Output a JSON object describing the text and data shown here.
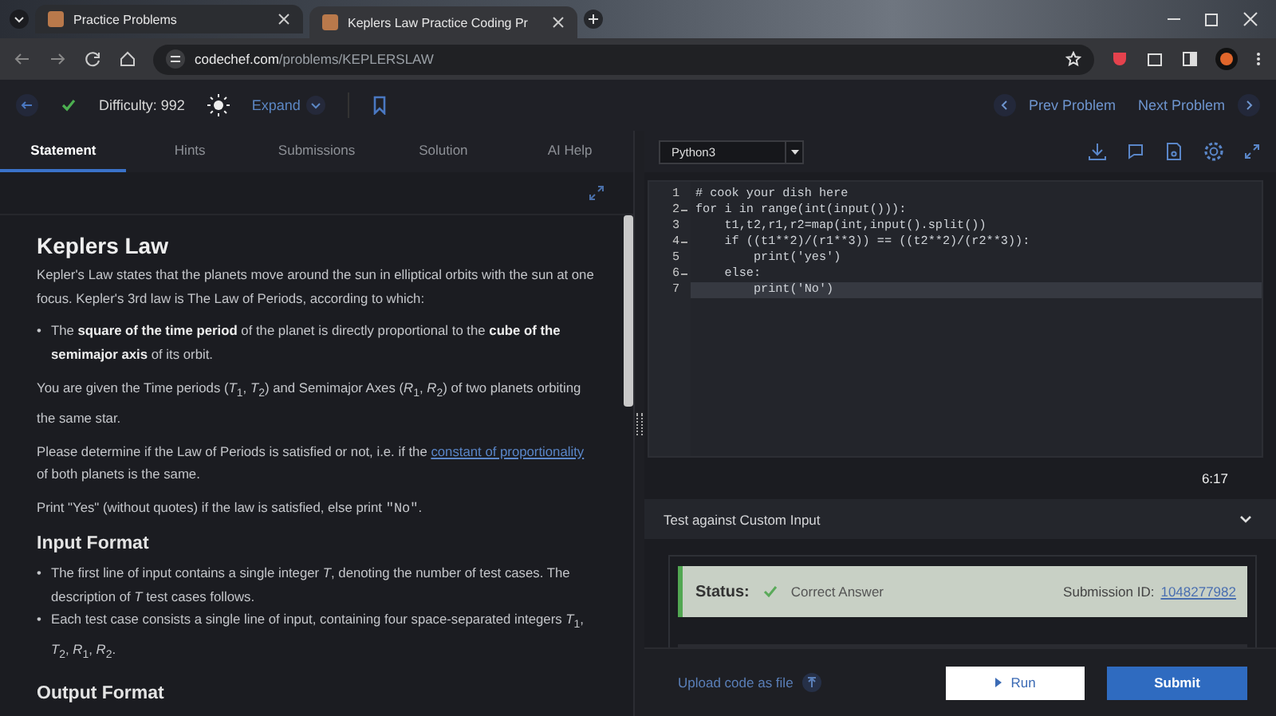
{
  "browser": {
    "tabs": [
      {
        "title": "Practice Problems",
        "selected": false
      },
      {
        "title": "Keplers Law Practice Coding Pr",
        "selected": true
      }
    ],
    "url_host": "codechef.com",
    "url_path": "/problems/KEPLERSLAW"
  },
  "toolbar": {
    "difficulty": "Difficulty: 992",
    "expand": "Expand",
    "prev": "Prev Problem",
    "next": "Next Problem"
  },
  "tabs": [
    {
      "label": "Statement",
      "selected": true
    },
    {
      "label": "Hints",
      "selected": false
    },
    {
      "label": "Submissions",
      "selected": false
    },
    {
      "label": "Solution",
      "selected": false
    },
    {
      "label": "AI Help",
      "selected": false
    }
  ],
  "problem": {
    "title": "Keplers Law",
    "blocks": [
      {
        "kind": "para",
        "segments": [
          {
            "kind": "text",
            "text": "Kepler's Law states that the planets move around the sun in elliptical orbits with the sun at one focus. Kepler's 3rd law is The Law of Periods, according to which:"
          }
        ]
      },
      {
        "kind": "bullets",
        "marker": "•",
        "items": [
          "The **square of the time period** of the planet is directly proportional to the **cube of the semimajor axis** of its orbit."
        ]
      },
      {
        "kind": "para",
        "segments": [
          {
            "kind": "text",
            "text": "You are given the Time periods (*T*$_{1}$, *T*$_{2}$) and Semimajor Axes (*R*$_{1}$, *R*$_{2}$) of two planets orbiting the same star."
          }
        ]
      },
      {
        "kind": "para",
        "segments": [
          {
            "kind": "text",
            "text": "Please determine if the Law of Periods is satisfied or not, i.e. if the "
          },
          {
            "kind": "link",
            "text": "constant of proportionality"
          },
          {
            "kind": "text",
            "text": " of both planets is the same."
          }
        ]
      },
      {
        "kind": "para",
        "segments": [
          {
            "kind": "text",
            "text": "Print \"Yes\" (without quotes) if the law is satisfied, else print "
          },
          {
            "kind": "code",
            "text": "\"No\""
          },
          {
            "kind": "text",
            "text": "."
          }
        ]
      },
      {
        "kind": "heading",
        "text": "Input Format"
      },
      {
        "kind": "bullets",
        "marker": "•",
        "items": [
          "The first line of input contains a single integer *T*, denoting the number of test cases. The description of *T* test cases follows.",
          "Each test case consists a single line of input, containing four space-separated integers *T*$_{1}$, *T*$_{2}$, *R*$_{1}$, *R*$_{2}$."
        ]
      },
      {
        "kind": "heading",
        "text": "Output Format"
      }
    ]
  },
  "editor": {
    "language": "Python3",
    "lines": [
      {
        "number": "1",
        "fold": false,
        "active": false,
        "text": "# cook your dish here"
      },
      {
        "number": "2",
        "fold": true,
        "active": false,
        "text": "for i in range(int(input())):"
      },
      {
        "number": "3",
        "fold": false,
        "active": false,
        "text": "    t1,t2,r1,r2=map(int,input().split())"
      },
      {
        "number": "4",
        "fold": true,
        "active": false,
        "text": "    if ((t1**2)/(r1**3)) == ((t2**2)/(r2**3)):"
      },
      {
        "number": "5",
        "fold": false,
        "active": false,
        "text": "        print('yes')"
      },
      {
        "number": "6",
        "fold": true,
        "active": false,
        "text": "    else:"
      },
      {
        "number": "7",
        "fold": false,
        "active": true,
        "text": "        print('No')"
      }
    ],
    "timer": "6:17"
  },
  "custom_input": {
    "title": "Test against Custom Input",
    "status_label": "Status:",
    "status": "Correct Answer",
    "submission_label": "Submission ID:",
    "submission_id": "1048277982"
  },
  "footer": {
    "upload": "Upload code as file",
    "run": "Run",
    "submit": "Submit"
  }
}
